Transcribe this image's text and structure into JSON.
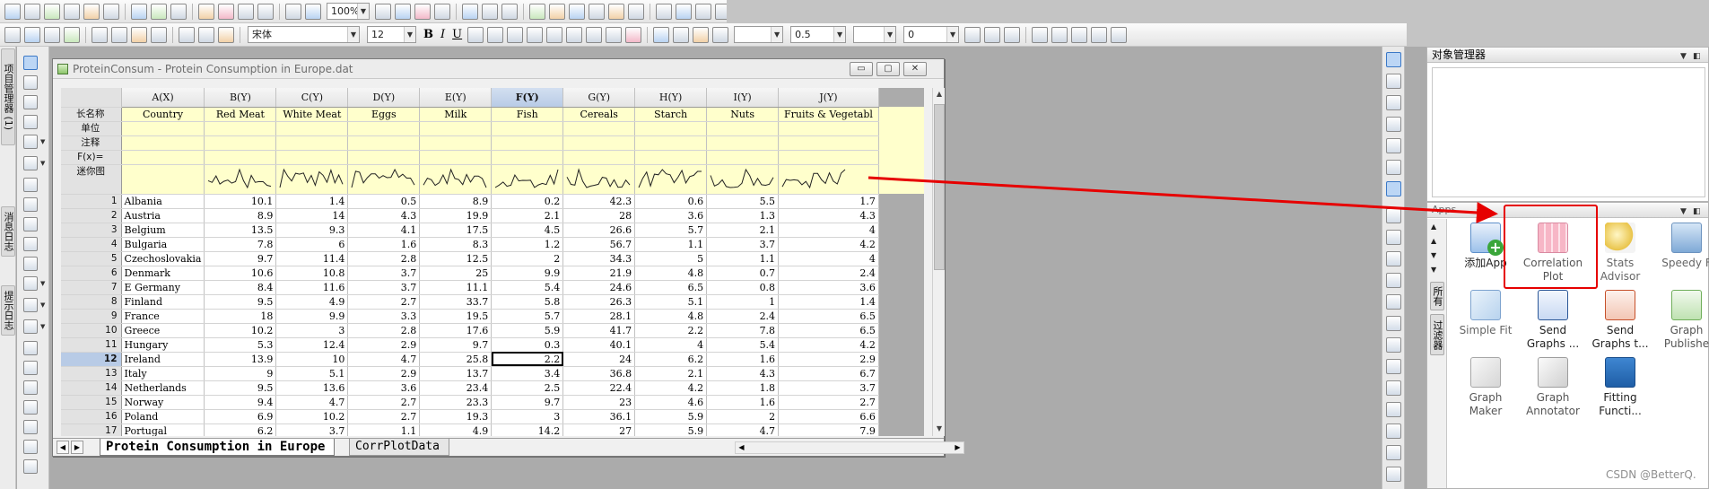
{
  "toolbar": {
    "zoom": "100%",
    "font_name": "宋体",
    "font_size": "12",
    "line_width": "0.5",
    "offset_value": "0",
    "text_buttons": [
      "B",
      "I",
      "U"
    ]
  },
  "left_tabs": [
    "项目管理器 (1)",
    "消息日志",
    "提示日志"
  ],
  "workbook": {
    "title": "ProteinConsum - Protein Consumption in Europe.dat",
    "window_buttons": [
      "▭",
      "▢",
      "✕"
    ],
    "columns": [
      "A(X)",
      "B(Y)",
      "C(Y)",
      "D(Y)",
      "E(Y)",
      "F(Y)",
      "G(Y)",
      "H(Y)",
      "I(Y)",
      "J(Y)"
    ],
    "selected_column": "F(Y)",
    "meta_labels": [
      "长名称",
      "单位",
      "注释",
      "F(x)=",
      "迷你图"
    ],
    "long_names": [
      "Country",
      "Red Meat",
      "White Meat",
      "Eggs",
      "Milk",
      "Fish",
      "Cereals",
      "Starch",
      "Nuts",
      "Fruits & Vegetabl"
    ],
    "rows": [
      {
        "n": "1",
        "cells": [
          "Albania",
          "10.1",
          "1.4",
          "0.5",
          "8.9",
          "0.2",
          "42.3",
          "0.6",
          "5.5",
          "1.7"
        ]
      },
      {
        "n": "2",
        "cells": [
          "Austria",
          "8.9",
          "14",
          "4.3",
          "19.9",
          "2.1",
          "28",
          "3.6",
          "1.3",
          "4.3"
        ]
      },
      {
        "n": "3",
        "cells": [
          "Belgium",
          "13.5",
          "9.3",
          "4.1",
          "17.5",
          "4.5",
          "26.6",
          "5.7",
          "2.1",
          "4"
        ]
      },
      {
        "n": "4",
        "cells": [
          "Bulgaria",
          "7.8",
          "6",
          "1.6",
          "8.3",
          "1.2",
          "56.7",
          "1.1",
          "3.7",
          "4.2"
        ]
      },
      {
        "n": "5",
        "cells": [
          "Czechoslovakia",
          "9.7",
          "11.4",
          "2.8",
          "12.5",
          "2",
          "34.3",
          "5",
          "1.1",
          "4"
        ]
      },
      {
        "n": "6",
        "cells": [
          "Denmark",
          "10.6",
          "10.8",
          "3.7",
          "25",
          "9.9",
          "21.9",
          "4.8",
          "0.7",
          "2.4"
        ]
      },
      {
        "n": "7",
        "cells": [
          "E Germany",
          "8.4",
          "11.6",
          "3.7",
          "11.1",
          "5.4",
          "24.6",
          "6.5",
          "0.8",
          "3.6"
        ]
      },
      {
        "n": "8",
        "cells": [
          "Finland",
          "9.5",
          "4.9",
          "2.7",
          "33.7",
          "5.8",
          "26.3",
          "5.1",
          "1",
          "1.4"
        ]
      },
      {
        "n": "9",
        "cells": [
          "France",
          "18",
          "9.9",
          "3.3",
          "19.5",
          "5.7",
          "28.1",
          "4.8",
          "2.4",
          "6.5"
        ]
      },
      {
        "n": "10",
        "cells": [
          "Greece",
          "10.2",
          "3",
          "2.8",
          "17.6",
          "5.9",
          "41.7",
          "2.2",
          "7.8",
          "6.5"
        ]
      },
      {
        "n": "11",
        "cells": [
          "Hungary",
          "5.3",
          "12.4",
          "2.9",
          "9.7",
          "0.3",
          "40.1",
          "4",
          "5.4",
          "4.2"
        ]
      },
      {
        "n": "12",
        "cells": [
          "Ireland",
          "13.9",
          "10",
          "4.7",
          "25.8",
          "2.2",
          "24",
          "6.2",
          "1.6",
          "2.9"
        ]
      },
      {
        "n": "13",
        "cells": [
          "Italy",
          "9",
          "5.1",
          "2.9",
          "13.7",
          "3.4",
          "36.8",
          "2.1",
          "4.3",
          "6.7"
        ]
      },
      {
        "n": "14",
        "cells": [
          "Netherlands",
          "9.5",
          "13.6",
          "3.6",
          "23.4",
          "2.5",
          "22.4",
          "4.2",
          "1.8",
          "3.7"
        ]
      },
      {
        "n": "15",
        "cells": [
          "Norway",
          "9.4",
          "4.7",
          "2.7",
          "23.3",
          "9.7",
          "23",
          "4.6",
          "1.6",
          "2.7"
        ]
      },
      {
        "n": "16",
        "cells": [
          "Poland",
          "6.9",
          "10.2",
          "2.7",
          "19.3",
          "3",
          "36.1",
          "5.9",
          "2",
          "6.6"
        ]
      },
      {
        "n": "17",
        "cells": [
          "Portugal",
          "6.2",
          "3.7",
          "1.1",
          "4.9",
          "14.2",
          "27",
          "5.9",
          "4.7",
          "7.9"
        ]
      }
    ],
    "selected_row": "12",
    "active_cell": {
      "row": "12",
      "col": "F(Y)"
    },
    "sheet_tabs": [
      "Protein Consumption in Europe",
      "CorrPlotData"
    ],
    "active_sheet": "Protein Consumption in Europe"
  },
  "object_manager": {
    "title": "对象管理器"
  },
  "apps_panel": {
    "title": "Apps",
    "side_tabs": [
      "所有",
      "过滤器"
    ],
    "apps": [
      {
        "label1": "添加App",
        "label2": "",
        "icon": "add-app-icon"
      },
      {
        "label1": "Correlation",
        "label2": "Plot",
        "icon": "correlation-plot-icon"
      },
      {
        "label1": "Stats",
        "label2": "Advisor",
        "icon": "stats-advisor-icon"
      },
      {
        "label1": "Speedy F",
        "label2": "",
        "icon": "speedy-fit-icon"
      },
      {
        "label1": "Simple Fit",
        "label2": "",
        "icon": "simple-fit-icon"
      },
      {
        "label1": "Send",
        "label2": "Graphs ...",
        "icon": "send-graphs-word-icon"
      },
      {
        "label1": "Send",
        "label2": "Graphs t...",
        "icon": "send-graphs-ppt-icon"
      },
      {
        "label1": "Graph",
        "label2": "Publishe",
        "icon": "graph-publisher-icon"
      },
      {
        "label1": "Graph",
        "label2": "Maker",
        "icon": "graph-maker-icon"
      },
      {
        "label1": "Graph",
        "label2": "Annotator",
        "icon": "graph-annotator-icon"
      },
      {
        "label1": "Fitting",
        "label2": "Functi...",
        "icon": "fitting-functions-icon"
      }
    ],
    "highlighted_app": "Correlation Plot"
  },
  "watermark": "CSDN @BetterQ.",
  "colors": {
    "annotation_red": "#e60000",
    "meta_row_yellow": "#ffffcc",
    "selected_header": "#b8cbe6"
  }
}
